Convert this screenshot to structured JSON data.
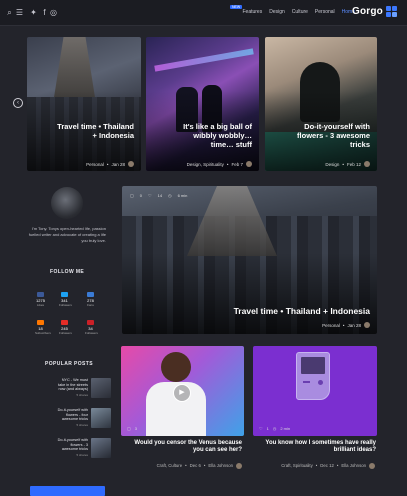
{
  "header": {
    "logo": "Gorgo",
    "badge": "NEW",
    "nav": [
      "Home",
      "Personal",
      "Culture",
      "Design",
      "Features"
    ]
  },
  "top_cards": [
    {
      "title": "Do-it-yourself with flowers - 3 awesome tricks",
      "date": "Feb 12",
      "category": "Design"
    },
    {
      "title": "It's like a big ball of wibbly wobbly… time… stuff",
      "date": "Feb 7",
      "category": "Design, Spirituality"
    },
    {
      "title": "Travel time • Thailand + Indonesia",
      "date": "Jan 28",
      "category": "Personal"
    }
  ],
  "author": {
    "bio": "I'm Tony. Tonys open-hearted life, passion fuelled writer and advocate of creating a life you truly love."
  },
  "follow": {
    "heading": "FOLLOW ME",
    "items": [
      {
        "count": "1275",
        "label": "Likes",
        "icon": "facebook-icon",
        "color": "#3b5998"
      },
      {
        "count": "341",
        "label": "Followers",
        "icon": "twitter-icon",
        "color": "#1da1f2"
      },
      {
        "count": "278",
        "label": "Fans",
        "icon": "flickr-icon",
        "color": "#3a7bd5"
      },
      {
        "count": "18",
        "label": "Subscribers",
        "icon": "soundcloud-icon",
        "color": "#ff7700"
      },
      {
        "count": "245",
        "label": "Followers",
        "icon": "youtube-icon",
        "color": "#e52d27"
      },
      {
        "count": "34",
        "label": "Followers",
        "icon": "pinterest-icon",
        "color": "#cb2027"
      }
    ]
  },
  "popular": {
    "heading": "POPULAR POSTS",
    "items": [
      {
        "title": "NYC - We must take in the streets now (and always)",
        "meta": "5 shares"
      },
      {
        "title": "Do-it-yourself with flowers - four awesome tricks",
        "meta": "5 shares"
      },
      {
        "title": "Do-it-yourself with flowers - 3 awesome tricks",
        "meta": "5 shares"
      }
    ]
  },
  "featured": {
    "title": "Travel time • Thailand + Indonesia",
    "date": "Jan 28",
    "category": "Personal",
    "views": "6 min",
    "likes": "14",
    "comments": "0"
  },
  "bottom_cards": [
    {
      "title": "You know how I sometimes have really brilliant ideas?",
      "author": "Ella Johnson",
      "date": "Dec 12",
      "category": "Craft, Spirituality",
      "time": "2 min",
      "likes": "1"
    },
    {
      "title": "Would you censor the Venus because you can see her?",
      "author": "Ella Johnson",
      "date": "Dec 6",
      "category": "Craft, Culture",
      "time": "4 min",
      "likes": "3"
    }
  ]
}
